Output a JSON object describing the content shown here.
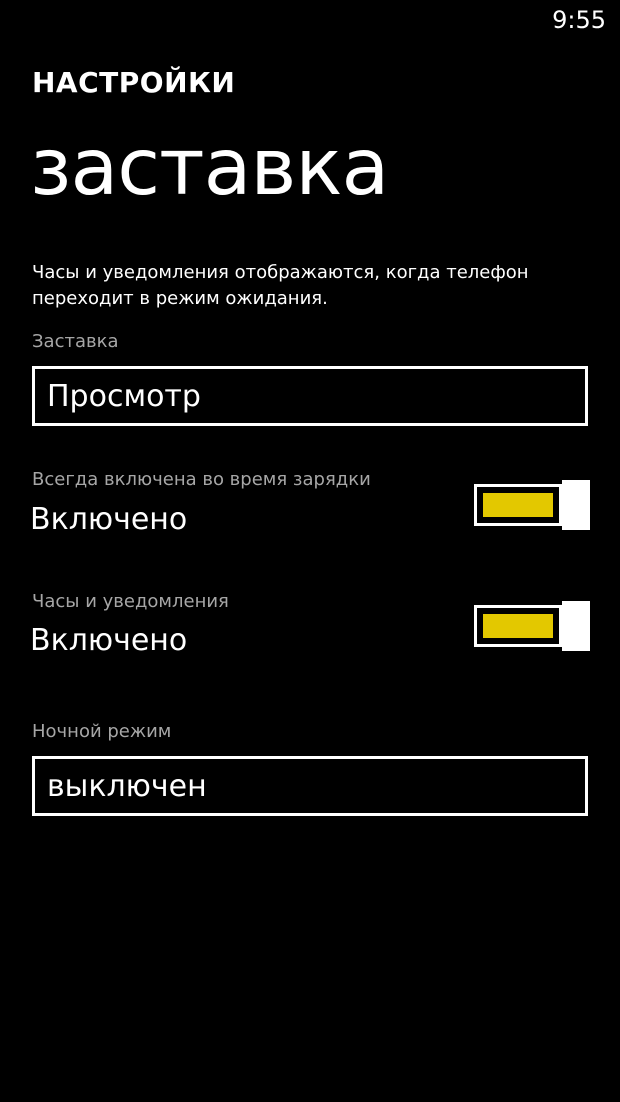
{
  "status_bar": {
    "time": "9:55"
  },
  "header": {
    "app_title": "НАСТРОЙКИ",
    "page_title": "заставка"
  },
  "description": "Часы и уведомления отображаются, когда телефон переходит в режим ожидания.",
  "screensaver": {
    "label": "Заставка",
    "value": "Просмотр"
  },
  "always_on_charging": {
    "label": "Всегда включена во время зарядки",
    "state_text": "Включено",
    "on": true
  },
  "clock_notifications": {
    "label": "Часы и уведомления",
    "state_text": "Включено",
    "on": true
  },
  "night_mode": {
    "label": "Ночной режим",
    "value": "выключен"
  },
  "colors": {
    "background": "#000000",
    "accent": "#e3c800",
    "foreground": "#ffffff",
    "secondary_text": "#a6a6a6"
  }
}
